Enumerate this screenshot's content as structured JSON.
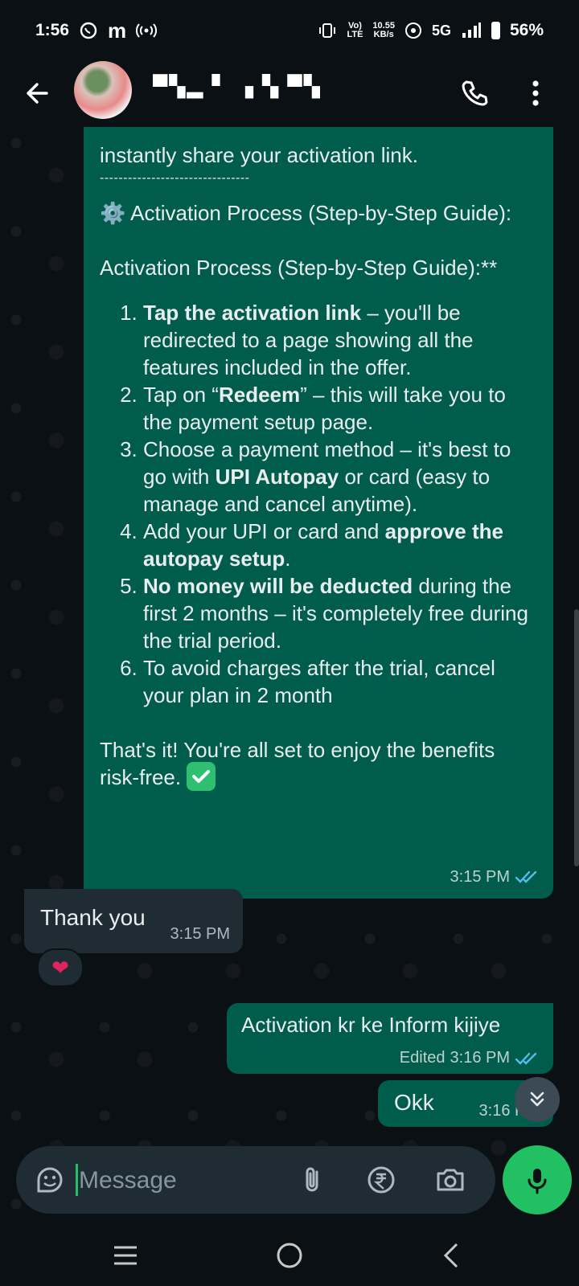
{
  "status_bar": {
    "time": "1:56",
    "app_glyph": "m",
    "network_speed_value": "10.55",
    "network_speed_unit": "KB/s",
    "volte_label": "Vo)",
    "lte_label": "LTE",
    "network_type": "5G",
    "battery_percent": "56%"
  },
  "header": {
    "contact_name": "▀▚▂ ▘ ▗ ▚   ▀▚"
  },
  "messages": {
    "big": {
      "intro": "instantly share your activation link.",
      "divider": "--------------------------------",
      "gear_emoji": "⚙️",
      "title": " Activation Process (Step-by-Step Guide):",
      "title_repeat": "Activation Process (Step-by-Step Guide):**",
      "steps": [
        {
          "bold": "Tap the activation link",
          "rest": " – you'll be redirected to a page showing all the features included in the offer."
        },
        {
          "pre": "Tap on “",
          "bold": "Redeem",
          "rest": "” – this will take you to the payment setup page."
        },
        {
          "pre": "Choose a payment method – it's best to go with ",
          "bold": "UPI Autopay",
          "rest": " or card (easy to manage and cancel anytime)."
        },
        {
          "pre": "Add your UPI or card and ",
          "bold": "approve the autopay setup",
          "rest": "."
        },
        {
          "bold": "No money will be deducted",
          "rest": " during the first 2 months – it's completely free during the trial period."
        },
        {
          "pre": "To avoid charges after the trial, cancel your plan in 2 month"
        }
      ],
      "closing": "That's it! You're all set to enjoy the benefits risk-free.",
      "time": "3:15 PM"
    },
    "thank_you": {
      "text": "Thank you",
      "time": "3:15 PM",
      "reaction": "❤"
    },
    "activation": {
      "text": "Activation kr ke Inform kijiye",
      "edited": "Edited",
      "time": "3:16 PM"
    },
    "okk": {
      "text": "Okk",
      "time": "3:16 PM"
    }
  },
  "composer": {
    "placeholder": "Message"
  },
  "colors": {
    "outgoing_bubble": "#005c4b",
    "incoming_bubble": "#202c33",
    "accent": "#21c063",
    "read_tick": "#53bdeb"
  }
}
